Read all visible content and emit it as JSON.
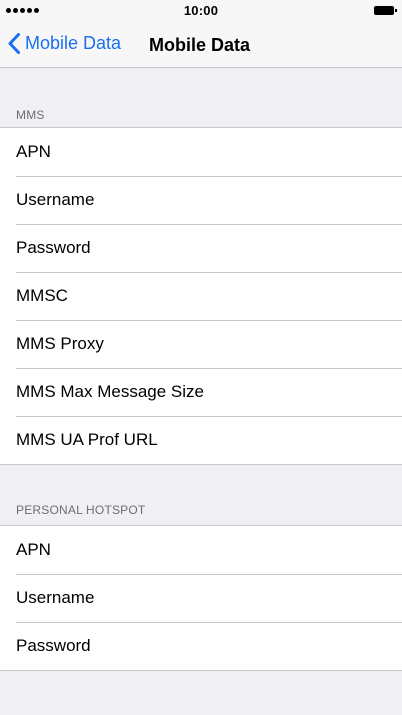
{
  "status_bar": {
    "time": "10:00",
    "signal_icon": "signal-dots-icon",
    "battery_icon": "battery-icon"
  },
  "nav": {
    "back_label": "Mobile Data",
    "back_icon": "chevron-left-icon",
    "title": "Mobile Data"
  },
  "sections": [
    {
      "header": "MMS",
      "items": [
        "APN",
        "Username",
        "Password",
        "MMSC",
        "MMS Proxy",
        "MMS Max Message Size",
        "MMS UA Prof URL"
      ]
    },
    {
      "header": "PERSONAL HOTSPOT",
      "items": [
        "APN",
        "Username",
        "Password"
      ]
    }
  ],
  "colors": {
    "accent": "#1a6ff0",
    "background": "#efeff4",
    "separator": "#c8c7cc",
    "section_header": "#6d6d72"
  }
}
